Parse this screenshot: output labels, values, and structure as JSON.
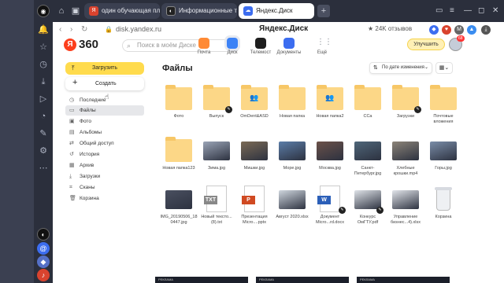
{
  "browser": {
    "tabs": [
      {
        "label": "один обучающая платф",
        "favicon": "Я",
        "color": "#d9432e"
      },
      {
        "label": "Информационные техн",
        "favicon": "◐",
        "color": "#222"
      },
      {
        "label": "Яндекс.Диск",
        "favicon": "☁",
        "color": "#3c6df0",
        "active": true
      }
    ],
    "address": {
      "url": "disk.yandex.ru",
      "title": "Яндекс.Диск",
      "reviews": "★ 24K отзывов"
    }
  },
  "header": {
    "logo": "Я",
    "logo_suffix": "360",
    "search_placeholder": "Поиск в моём Диске",
    "services": [
      {
        "label": "Почта",
        "color": "#ff8a35"
      },
      {
        "label": "Диск",
        "color": "#3c82f6",
        "selected": true
      },
      {
        "label": "Телемост",
        "color": "#1e1e1e"
      },
      {
        "label": "Документы",
        "color": "#3c6df0"
      },
      {
        "label": "Ещё",
        "color": "#8a8f99"
      }
    ],
    "upgrade_label": "Улучшить",
    "avatar_badge": "68"
  },
  "sidebar": {
    "upload_label": "Загрузить",
    "create_label": "Создать",
    "items": [
      {
        "label": "Последние",
        "icon": "clock-icon"
      },
      {
        "label": "Файлы",
        "icon": "folder-icon",
        "selected": true
      },
      {
        "label": "Фото",
        "icon": "photo-icon"
      },
      {
        "label": "Альбомы",
        "icon": "album-icon"
      },
      {
        "label": "Общий доступ",
        "icon": "share-icon"
      },
      {
        "label": "История",
        "icon": "history-icon"
      },
      {
        "label": "Архив",
        "icon": "archive-icon"
      },
      {
        "label": "Загрузки",
        "icon": "download-icon"
      },
      {
        "label": "Сканы",
        "icon": "scan-icon"
      },
      {
        "label": "Корзина",
        "icon": "trash-icon"
      }
    ]
  },
  "main": {
    "title": "Файлы",
    "sort_label": "По дате изменения",
    "files": [
      {
        "name": "Фото",
        "kind": "folder"
      },
      {
        "name": "Выпуск",
        "kind": "folder",
        "edit": true
      },
      {
        "name": "OmDent&ASD",
        "kind": "shared-folder"
      },
      {
        "name": "Новая папка",
        "kind": "folder"
      },
      {
        "name": "Новая папка2",
        "kind": "shared-folder"
      },
      {
        "name": "CCa",
        "kind": "folder"
      },
      {
        "name": "Загрузки",
        "kind": "folder",
        "edit": true
      },
      {
        "name": "Почтовые вложения",
        "kind": "folder"
      },
      {
        "name": "Новая папка123",
        "kind": "folder"
      },
      {
        "name": "Зима.jpg",
        "kind": "photo",
        "color": "#9aa4b6"
      },
      {
        "name": "Мишки.jpg",
        "kind": "photo",
        "color": "#7b6a55"
      },
      {
        "name": "Море.jpg",
        "kind": "photo",
        "color": "#5b7da8"
      },
      {
        "name": "Москва.jpg",
        "kind": "photo",
        "color": "#6b5149"
      },
      {
        "name": "Санкт-Петербург.jpg",
        "kind": "photo",
        "color": "#4f6679"
      },
      {
        "name": "Хлебные крошки.mp4",
        "kind": "photo",
        "color": "#8c8478"
      },
      {
        "name": "Горы.jpg",
        "kind": "photo",
        "color": "#7a8da8"
      },
      {
        "name": "IMG_20190506_180447.jpg",
        "kind": "photo",
        "color": "#4a5060"
      },
      {
        "name": "Новый тексто...(8).txt",
        "kind": "doc",
        "tag": "TXT",
        "tagcolor": "#888"
      },
      {
        "name": "Презентация Micro....pptx",
        "kind": "doc",
        "tag": "P",
        "tagcolor": "#d04a22"
      },
      {
        "name": "Август 2020.xlsx",
        "kind": "photo",
        "color": "#cfd6de"
      },
      {
        "name": "Документ Micro...rd.docx",
        "kind": "doc",
        "tag": "W",
        "tagcolor": "#2b5fb8",
        "edit": true
      },
      {
        "name": "Конкурс ОмГТУ.pdf",
        "kind": "photo",
        "color": "#dfe3e8",
        "edit": true
      },
      {
        "name": "Управление бизнес...4).xlsx",
        "kind": "photo",
        "color": "#e2e5ea"
      },
      {
        "name": "Корзина",
        "kind": "trash"
      }
    ]
  },
  "ads": [
    "РЕКЛАМА",
    "РЕКЛАМА",
    "РЕКЛАМА"
  ]
}
